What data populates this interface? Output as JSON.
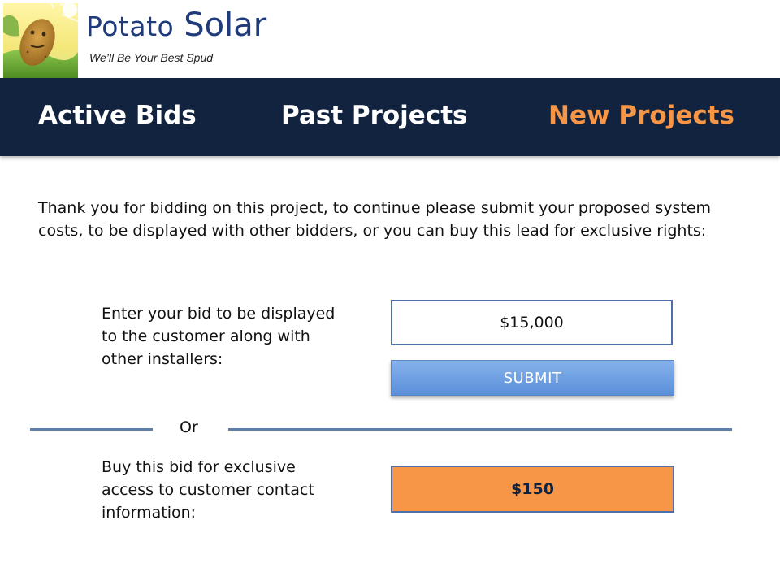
{
  "brand": {
    "name_first": "Potato",
    "name_second": "Solar",
    "tagline": "We’ll Be Your Best Spud"
  },
  "nav": {
    "items": [
      {
        "label": "Active Bids",
        "active": false
      },
      {
        "label": "Past Projects",
        "active": false
      },
      {
        "label": "New Projects",
        "active": true
      }
    ]
  },
  "intro": {
    "text": "Thank you for bidding on this project, to continue please submit your proposed system costs, to be displayed with other bidders, or you can buy this lead for exclusive rights:"
  },
  "bid": {
    "label": "Enter your bid to be displayed to the customer along with other installers:",
    "value": "$15,000",
    "submit_label": "SUBMIT"
  },
  "separator": {
    "label": "Or"
  },
  "buy": {
    "label": "Buy this bid for exclusive access to customer contact information:",
    "price_label": "$150"
  },
  "colors": {
    "brand_blue": "#1f3b7a",
    "nav_background": "#11233e",
    "active_nav": "#f79646",
    "submit_button": "#5a8fd9",
    "buy_button": "#f79646",
    "divider": "#5e7fa8"
  },
  "icons": {
    "logo": "potato-mascot-logo"
  }
}
